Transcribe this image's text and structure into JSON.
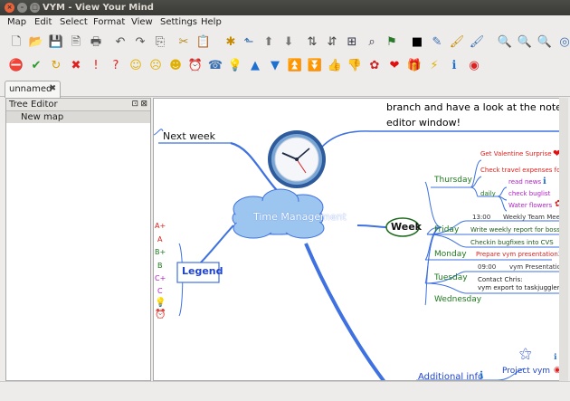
{
  "window": {
    "title": "VYM - View Your Mind",
    "close_glyph": "×",
    "minimize_glyph": "–",
    "maximize_glyph": "□"
  },
  "menu": [
    "Map",
    "Edit",
    "Select",
    "Format",
    "View",
    "Settings",
    "Help"
  ],
  "toolbar1": [
    {
      "icon": "new-file-icon",
      "glyph": "🗋",
      "color": "#555"
    },
    {
      "icon": "open-folder-icon",
      "glyph": "📂",
      "color": "#3a6fb0"
    },
    {
      "icon": "save-icon",
      "glyph": "💾",
      "color": "#444"
    },
    {
      "icon": "export-icon",
      "glyph": "🖹",
      "color": "#555"
    },
    {
      "icon": "print-icon",
      "glyph": "🖶",
      "color": "#555"
    },
    {
      "icon": "undo-icon",
      "glyph": "↶",
      "color": "#555"
    },
    {
      "icon": "redo-icon",
      "glyph": "↷",
      "color": "#555"
    },
    {
      "icon": "copy-icon",
      "glyph": "⎘",
      "color": "#555"
    },
    {
      "icon": "cut-icon",
      "glyph": "✂",
      "color": "#b58a1e"
    },
    {
      "icon": "paste-icon",
      "glyph": "📋",
      "color": "#888"
    },
    {
      "icon": "add-branch-icon",
      "glyph": "✱",
      "color": "#c58a00"
    },
    {
      "icon": "add-branch-above-icon",
      "glyph": "⬑",
      "color": "#3a6fb0"
    },
    {
      "icon": "move-up-icon",
      "glyph": "⬆",
      "color": "#777"
    },
    {
      "icon": "move-down-icon",
      "glyph": "⬇",
      "color": "#777"
    },
    {
      "icon": "sort-asc-icon",
      "glyph": "⇅",
      "color": "#444"
    },
    {
      "icon": "sort-desc-icon",
      "glyph": "⇵",
      "color": "#444"
    },
    {
      "icon": "map-view-icon",
      "glyph": "⊞",
      "color": "#334"
    },
    {
      "icon": "find-icon",
      "glyph": "⌕",
      "color": "#334"
    },
    {
      "icon": "flag-icon",
      "glyph": "⚑",
      "color": "#2a7a2a"
    },
    {
      "icon": "color-square-icon",
      "glyph": "■",
      "color": "#000"
    },
    {
      "icon": "pick-color-icon",
      "glyph": "✎",
      "color": "#3a6fb0"
    },
    {
      "icon": "format-copy-icon",
      "glyph": "🖌",
      "color": "#c58a00"
    },
    {
      "icon": "format-paste-icon",
      "glyph": "🖌",
      "color": "#3a6fb0"
    },
    {
      "icon": "zoom-in-icon",
      "glyph": "🔍",
      "color": "#3a6fb0"
    },
    {
      "icon": "zoom-out-icon",
      "glyph": "🔍",
      "color": "#3a6fb0"
    },
    {
      "icon": "zoom-reset-icon",
      "glyph": "🔍",
      "color": "#3a6fb0"
    },
    {
      "icon": "center-icon",
      "glyph": "◎",
      "color": "#3a6fb0"
    }
  ],
  "toolbar2": [
    {
      "icon": "stop-icon",
      "glyph": "⛔",
      "color": "#d22"
    },
    {
      "icon": "check-icon",
      "glyph": "✔",
      "color": "#2a9a2a"
    },
    {
      "icon": "refresh-icon",
      "glyph": "↻",
      "color": "#d8a000"
    },
    {
      "icon": "cross-icon",
      "glyph": "✖",
      "color": "#d22"
    },
    {
      "icon": "exclamation-icon",
      "glyph": "!",
      "color": "#d22"
    },
    {
      "icon": "question-icon",
      "glyph": "?",
      "color": "#d22"
    },
    {
      "icon": "smiley-good-icon",
      "glyph": "☺",
      "color": "#e0b000"
    },
    {
      "icon": "smiley-neutral-icon",
      "glyph": "☹",
      "color": "#e0b000"
    },
    {
      "icon": "smiley-omg-icon",
      "glyph": "☻",
      "color": "#e0b000"
    },
    {
      "icon": "clock-icon",
      "glyph": "⏰",
      "color": "#b07a00"
    },
    {
      "icon": "phone-icon",
      "glyph": "☎",
      "color": "#3a6fb0"
    },
    {
      "icon": "lamp-icon",
      "glyph": "💡",
      "color": "#e0b000"
    },
    {
      "icon": "arrow-up-icon",
      "glyph": "▲",
      "color": "#1f6fd0"
    },
    {
      "icon": "arrow-down-icon",
      "glyph": "▼",
      "color": "#1f6fd0"
    },
    {
      "icon": "arrow-up-double-icon",
      "glyph": "⏫",
      "color": "#1f6fd0"
    },
    {
      "icon": "arrow-down-double-icon",
      "glyph": "⏬",
      "color": "#1f6fd0"
    },
    {
      "icon": "thumb-up-icon",
      "glyph": "👍",
      "color": "#c58a00"
    },
    {
      "icon": "thumb-down-icon",
      "glyph": "👎",
      "color": "#c58a00"
    },
    {
      "icon": "rose-icon",
      "glyph": "✿",
      "color": "#c22"
    },
    {
      "icon": "heart-icon",
      "glyph": "❤",
      "color": "#e01010"
    },
    {
      "icon": "present-icon",
      "glyph": "🎁",
      "color": "#c22"
    },
    {
      "icon": "flash-icon",
      "glyph": "⚡",
      "color": "#e0b000"
    },
    {
      "icon": "info-icon",
      "glyph": "ℹ",
      "color": "#1f6fd0"
    },
    {
      "icon": "lifebelt-icon",
      "glyph": "◉",
      "color": "#d22"
    }
  ],
  "tab": {
    "label": "unnamed",
    "close_glyph": "✖"
  },
  "tree_editor": {
    "title": "Tree Editor",
    "float_glyph": "⊡",
    "close_glyph": "⊠",
    "item": "New map"
  },
  "map": {
    "top_note_line1": "branch and have a look at the note",
    "top_note_line2": "editor window!",
    "central": "Time Management",
    "next_week": "Next week",
    "week": "Week",
    "legend": "Legend",
    "legend_items": [
      "A+",
      "A",
      "B+",
      "B",
      "C+",
      "C"
    ],
    "days": [
      "Thursday",
      "Friday",
      "Monday",
      "Tuesday",
      "Wednesday"
    ],
    "thu_items": [
      "Get Valentine Surprise",
      "Check travel expenses for"
    ],
    "daily": "daily",
    "daily_items": [
      "read news",
      "check buglist",
      "Water flowers"
    ],
    "fri_time": "13:00",
    "fri_meeting": "Weekly Team Meeti",
    "fri_items": [
      "Write weekly report for boss",
      "Checkin bugfixes into CVS"
    ],
    "mon_item": "Prepare vym presentation",
    "tue_time": "09:00",
    "tue_item": "vym Presentation",
    "tue_contact1": "Contact Chris:",
    "tue_contact2": "vym export to taskjuggler",
    "additional": "Additional info",
    "project": "Project vym",
    "colors": {
      "link": "#3f72e0",
      "central_fill": "#9cc5ef",
      "red": "#e0201c",
      "purple": "#b020c8",
      "green": "#1d7a1d",
      "dark": "#222"
    }
  }
}
